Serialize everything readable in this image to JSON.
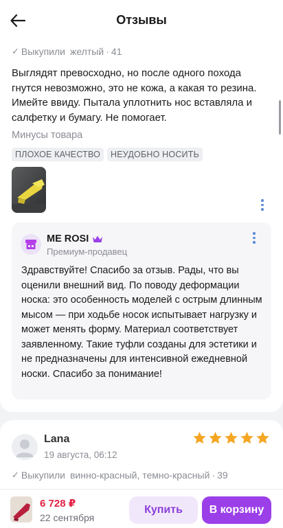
{
  "header": {
    "title": "Отзывы",
    "back_icon": "arrow-left-icon"
  },
  "review1": {
    "purchased_label": "Выкупили",
    "variant": "желтый",
    "size_sep": "·",
    "size": "41",
    "text": "Выглядят превосходно, но после одного похода гнутся невозможно, это не кожа, а какая то резина. Имейте ввиду. Пытала уплотнить нос вставляла и салфетку и бумагу. Не помогает.",
    "cons_label": "Минусы товара",
    "tags": [
      "ПЛОХОЕ КАЧЕСТВО",
      "НЕУДОБНО НОСИТЬ"
    ]
  },
  "seller_reply": {
    "seller_name": "ME ROSI",
    "seller_badge_icon": "crown-icon",
    "seller_role": "Премиум-продавец",
    "text": "Здравствуйте! Спасибо за отзыв. Рады, что вы оценили внешний вид. По поводу деформации носка: это особенность моделей с острым длинным мысом — при ходьбе носок испытывает нагрузку и может менять форму. Материал соответствует заявленному. Такие туфли созданы для эстетики и не предназначены для интенсивной ежедневной носки. Спасибо за понимание!"
  },
  "review2": {
    "user_name": "Lana",
    "date": "19 августа, 06:12",
    "rating": 5,
    "purchased_label": "Выкупили",
    "variant": "винно-красный, темно-красный",
    "size_sep": "·",
    "size": "39"
  },
  "bottom_bar": {
    "price": "6 728 ₽",
    "delivery_date": "22 сентября",
    "buy_label": "Купить",
    "cart_label": "В корзину"
  },
  "colors": {
    "accent": "#9b3fe8",
    "price": "#e01f43",
    "star": "#f5a623",
    "link_dots": "#5b8ad8"
  }
}
